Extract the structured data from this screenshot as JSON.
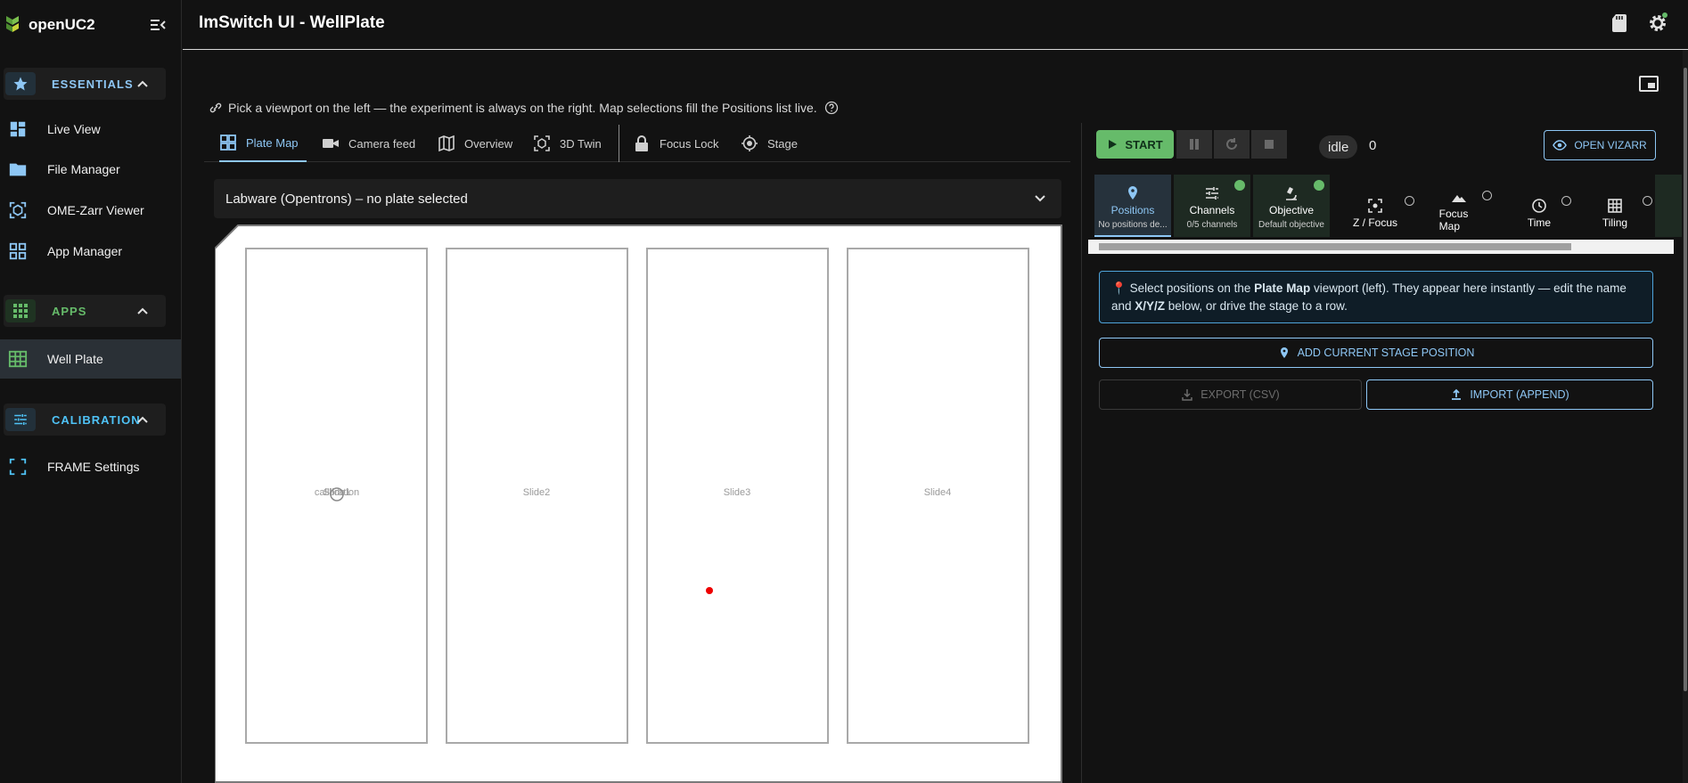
{
  "brand": {
    "name": "openUC2"
  },
  "sidebar": {
    "sections": [
      {
        "label": "ESSENTIALS",
        "color": "#8ec7f5"
      },
      {
        "label": "APPS",
        "color": "#66bb6a"
      },
      {
        "label": "CALIBRATION",
        "color": "#4fc3f7"
      }
    ],
    "items": [
      {
        "label": "Live View",
        "icon": "dashboard-icon"
      },
      {
        "label": "File Manager",
        "icon": "folder-icon"
      },
      {
        "label": "OME-Zarr Viewer",
        "icon": "viewer-icon"
      },
      {
        "label": "App Manager",
        "icon": "apps-icon"
      },
      {
        "label": "Well Plate",
        "icon": "grid-icon"
      },
      {
        "label": "FRAME Settings",
        "icon": "frame-icon"
      }
    ]
  },
  "header": {
    "title": "ImSwitch UI - WellPlate"
  },
  "hint": {
    "text": "Pick a viewport on the left — the experiment is always on the right. Map selections fill the Positions list live."
  },
  "tabs": [
    {
      "label": "Plate Map"
    },
    {
      "label": "Camera feed"
    },
    {
      "label": "Overview"
    },
    {
      "label": "3D Twin"
    },
    {
      "label": "Focus Lock"
    },
    {
      "label": "Stage"
    }
  ],
  "labware": {
    "label": "Labware (Opentrons) – no plate selected"
  },
  "plate": {
    "slots": [
      "Slide1",
      "Slide2",
      "Slide3",
      "Slide4"
    ],
    "overlay_label": "calibration"
  },
  "controls": {
    "start": "START",
    "status": "idle",
    "count": "0",
    "vizarr": "OPEN VIZARR"
  },
  "steps": [
    {
      "title": "Positions",
      "sub": "No positions de..."
    },
    {
      "title": "Channels",
      "sub": "0/5 channels"
    },
    {
      "title": "Objective",
      "sub": "Default objective"
    },
    {
      "title": "Z / Focus"
    },
    {
      "title": "Focus\nMap"
    },
    {
      "title": "Time"
    },
    {
      "title": "Tiling"
    }
  ],
  "positions_panel": {
    "alert_pre": "Select positions on the ",
    "alert_bold1": "Plate Map",
    "alert_mid": " viewport (left). They appear here instantly — edit the name and ",
    "alert_bold2": "X/Y/Z",
    "alert_post": " below, or drive the stage to a row.",
    "add_btn": "ADD CURRENT STAGE POSITION",
    "export_btn": "EXPORT (CSV)",
    "import_btn": "IMPORT (APPEND)"
  },
  "colors": {
    "accent": "#8ec7f5",
    "success": "#66bb6a",
    "marker": "#ee0000"
  }
}
